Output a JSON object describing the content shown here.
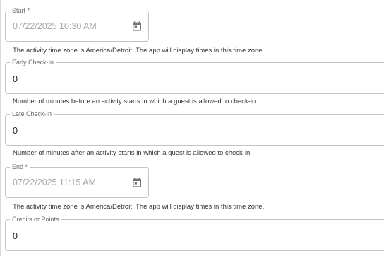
{
  "start": {
    "label": "Start *",
    "value": "07/22/2025 10:30 AM",
    "helper": "The activity time zone is America/Detroit. The app will display times in this time zone."
  },
  "early_checkin": {
    "label": "Early Check-In",
    "value": "0",
    "helper": "Number of minutes before an activity starts in which a guest is allowed to check-in"
  },
  "late_checkin": {
    "label": "Late Check-In",
    "value": "0",
    "helper": "Number of minutes after an activity starts in which a guest is allowed to check-in"
  },
  "end": {
    "label": "End *",
    "value": "07/22/2025 11:15 AM",
    "helper": "The activity time zone is America/Detroit. The app will display times in this time zone."
  },
  "credits": {
    "label": "Credits or Points",
    "value": "0"
  },
  "icons": {
    "start_picker": "calendar-icon",
    "end_picker": "calendar-icon"
  }
}
